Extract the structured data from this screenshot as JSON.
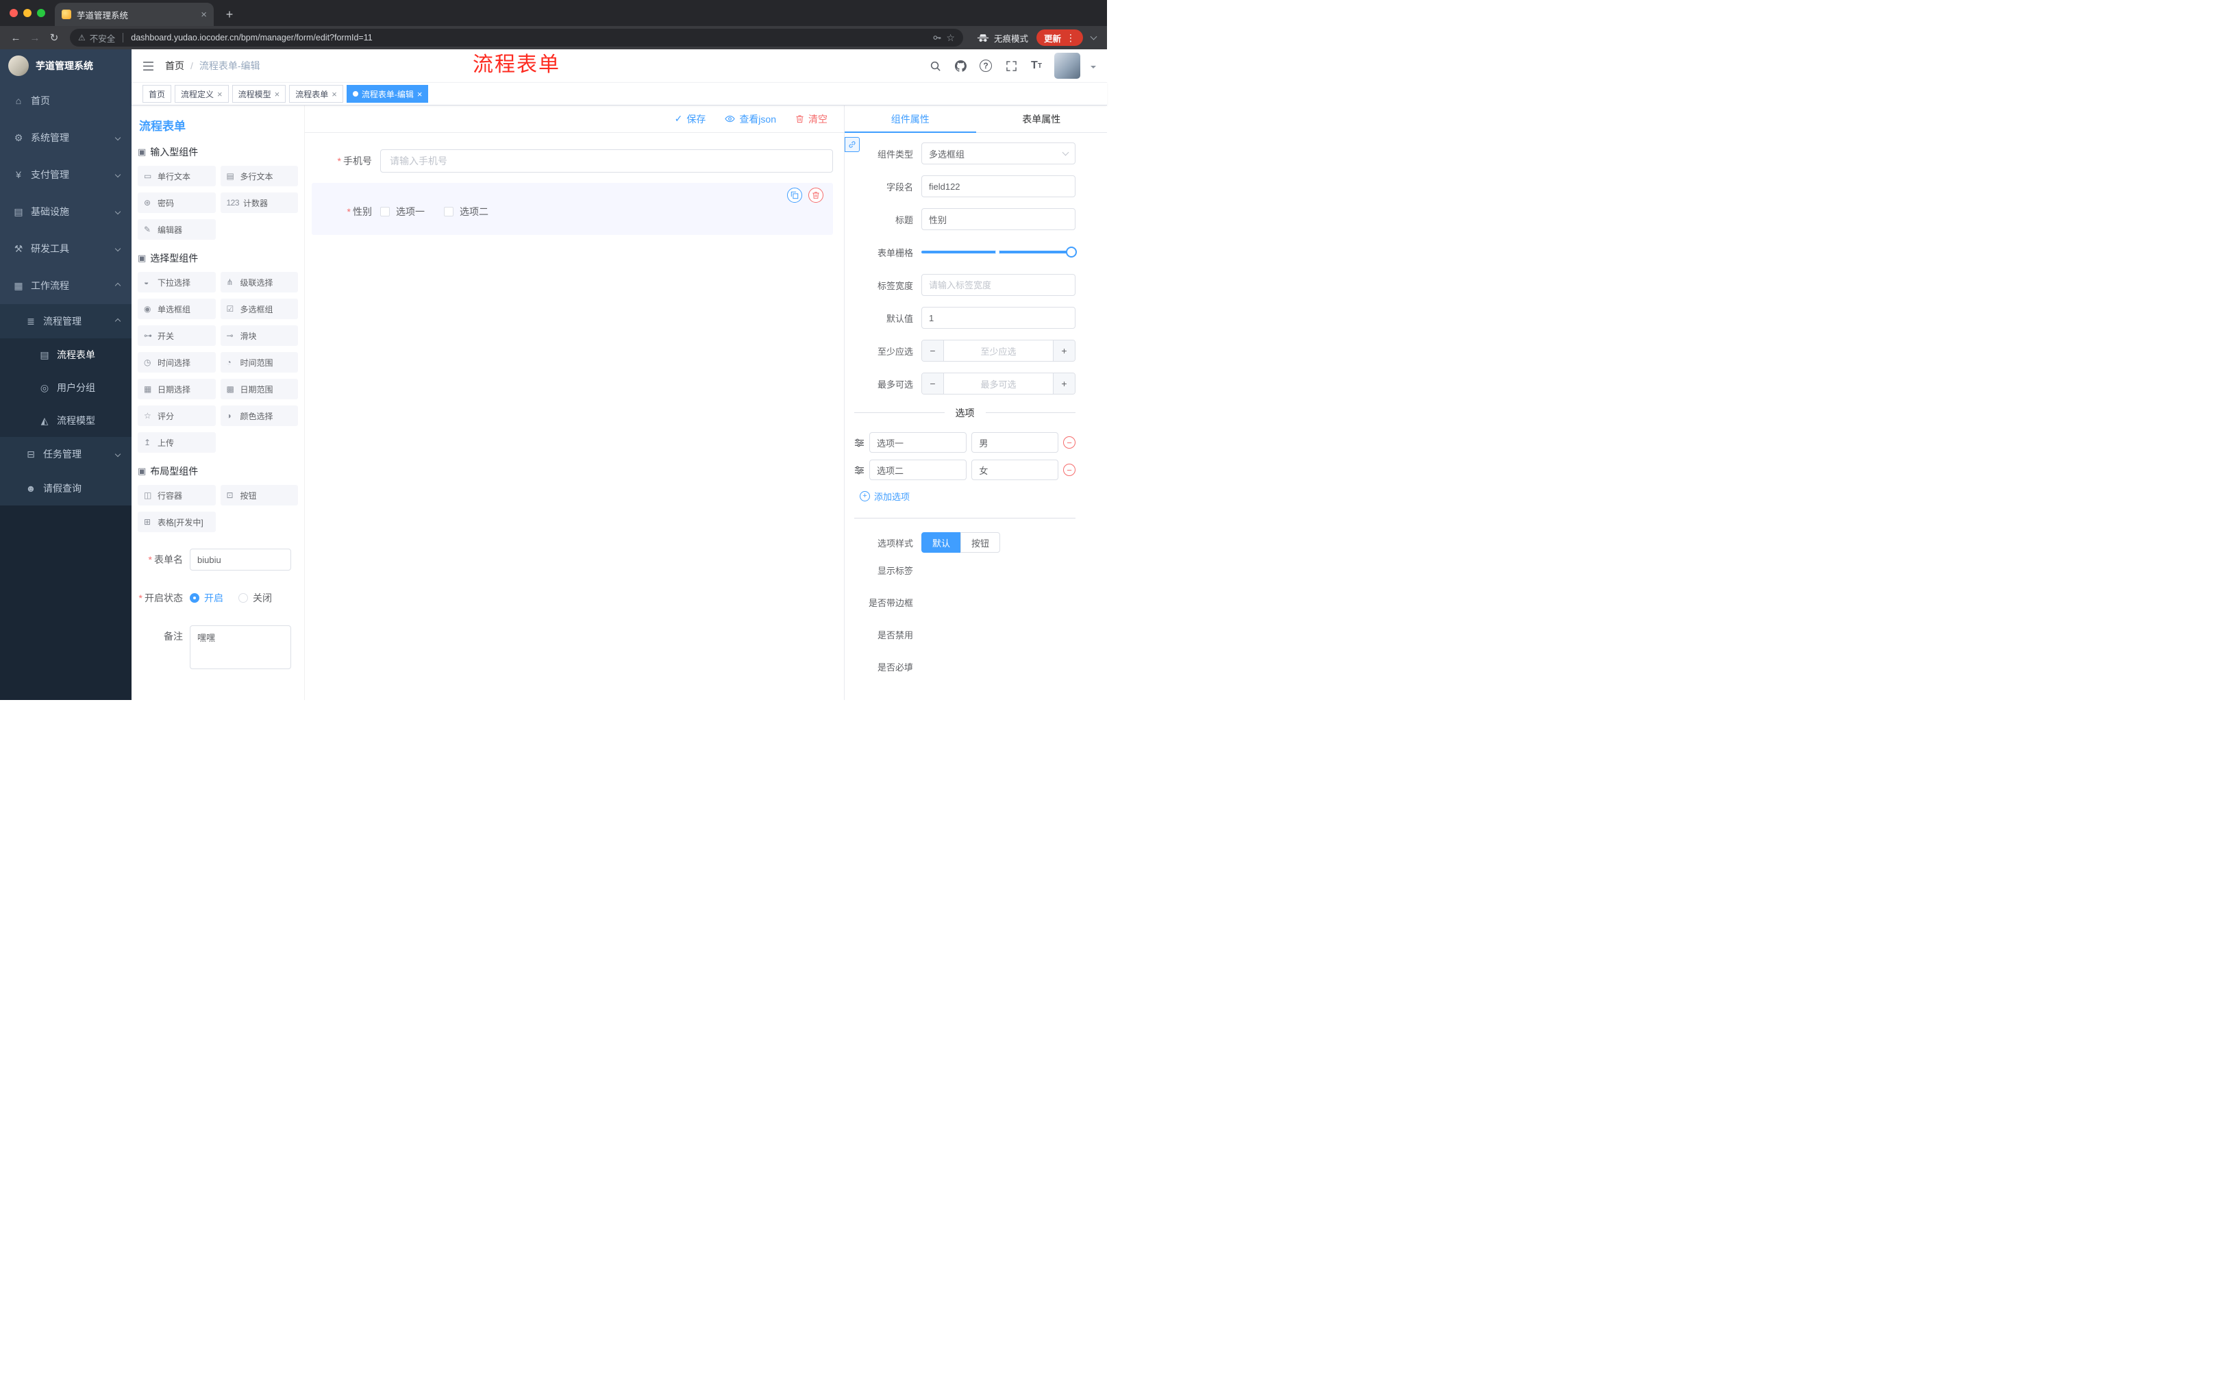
{
  "colors": {
    "accent": "#409EFF",
    "danger": "#F56C6C",
    "annotation_red": "#FD2B20",
    "sidebar_bg": "#304156",
    "active_tag_bg": "#409EFF"
  },
  "chrome": {
    "tab_title": "芋道管理系统",
    "security_label": "不安全",
    "url": "dashboard.yudao.iocoder.cn/bpm/manager/form/edit?formId=11",
    "incognito_label": "无痕模式",
    "update_label": "更新"
  },
  "sidebar": {
    "logo_title": "芋道管理系统",
    "items": [
      {
        "label": "首页",
        "icon": "home-icon",
        "glyph": "⌂"
      },
      {
        "label": "系统管理",
        "icon": "gear-icon",
        "glyph": "⚙"
      },
      {
        "label": "支付管理",
        "icon": "yen-icon",
        "glyph": "¥"
      },
      {
        "label": "基础设施",
        "icon": "infrastructure-icon",
        "glyph": "▤"
      },
      {
        "label": "研发工具",
        "icon": "tools-icon",
        "glyph": "⚒"
      },
      {
        "label": "工作流程",
        "icon": "workflow-icon",
        "glyph": "▦"
      },
      {
        "label": "流程管理",
        "icon": "list-icon",
        "glyph": "≣"
      },
      {
        "label": "流程表单",
        "icon": "document-icon",
        "glyph": "▤",
        "active": true
      },
      {
        "label": "用户分组",
        "icon": "users-icon",
        "glyph": "◎"
      },
      {
        "label": "流程模型",
        "icon": "send-icon",
        "glyph": "◭"
      },
      {
        "label": "任务管理",
        "icon": "tasks-icon",
        "glyph": "⊟"
      },
      {
        "label": "请假查询",
        "icon": "person-icon",
        "glyph": "☻"
      }
    ]
  },
  "header": {
    "breadcrumb_home": "首页",
    "breadcrumb_sep": "/",
    "breadcrumb_current": "流程表单-编辑",
    "annotation": "流程表单"
  },
  "tags": [
    {
      "label": "首页",
      "closable": false,
      "active": false
    },
    {
      "label": "流程定义",
      "closable": true,
      "active": false
    },
    {
      "label": "流程模型",
      "closable": true,
      "active": false
    },
    {
      "label": "流程表单",
      "closable": true,
      "active": false
    },
    {
      "label": "流程表单-编辑",
      "closable": true,
      "active": true
    }
  ],
  "designer": {
    "panel_title": "流程表单",
    "actions": {
      "save": "保存",
      "view_json": "查看json",
      "clear": "清空"
    },
    "sections": [
      {
        "title": "输入型组件",
        "glyph": "▣",
        "items": [
          {
            "label": "单行文本",
            "icon": "single-line-text-icon",
            "glyph": "▭"
          },
          {
            "label": "多行文本",
            "icon": "multi-line-text-icon",
            "glyph": "▤"
          },
          {
            "label": "密码",
            "icon": "password-icon",
            "glyph": "⊛"
          },
          {
            "label": "计数器",
            "icon": "counter-icon",
            "glyph": "123"
          },
          {
            "label": "编辑器",
            "icon": "editor-icon",
            "glyph": "✎"
          }
        ]
      },
      {
        "title": "选择型组件",
        "glyph": "▣",
        "items": [
          {
            "label": "下拉选择",
            "icon": "dropdown-icon",
            "glyph": "◒"
          },
          {
            "label": "级联选择",
            "icon": "cascader-icon",
            "glyph": "⋔"
          },
          {
            "label": "单选框组",
            "icon": "radio-group-icon",
            "glyph": "◉"
          },
          {
            "label": "多选框组",
            "icon": "checkbox-group-icon",
            "glyph": "☑"
          },
          {
            "label": "开关",
            "icon": "switch-icon",
            "glyph": "⊶"
          },
          {
            "label": "滑块",
            "icon": "slider-icon",
            "glyph": "⊸"
          },
          {
            "label": "时间选择",
            "icon": "time-picker-icon",
            "glyph": "◷"
          },
          {
            "label": "时间范围",
            "icon": "time-range-icon",
            "glyph": "◔"
          },
          {
            "label": "日期选择",
            "icon": "date-picker-icon",
            "glyph": "▦"
          },
          {
            "label": "日期范围",
            "icon": "date-range-icon",
            "glyph": "▩"
          },
          {
            "label": "评分",
            "icon": "rate-icon",
            "glyph": "☆"
          },
          {
            "label": "颜色选择",
            "icon": "color-picker-icon",
            "glyph": "◑"
          },
          {
            "label": "上传",
            "icon": "upload-icon",
            "glyph": "↥"
          }
        ]
      },
      {
        "title": "布局型组件",
        "glyph": "▣",
        "items": [
          {
            "label": "行容器",
            "icon": "row-container-icon",
            "glyph": "◫"
          },
          {
            "label": "按钮",
            "icon": "button-icon",
            "glyph": "⊡"
          },
          {
            "label": "表格[开发中]",
            "icon": "table-icon",
            "glyph": "⊞"
          }
        ]
      }
    ],
    "meta": {
      "name_label": "表单名",
      "name_value": "biubiu",
      "status_label": "开启状态",
      "status_on": "开启",
      "status_off": "关闭",
      "status_value": "开启",
      "remark_label": "备注",
      "remark_value": "嘿嘿"
    },
    "canvas": {
      "phone_label": "手机号",
      "phone_placeholder": "请输入手机号",
      "gender_label": "性别",
      "gender_options": [
        "选项一",
        "选项二"
      ]
    }
  },
  "props": {
    "tabs": {
      "component": "组件属性",
      "form": "表单属性"
    },
    "type_label": "组件类型",
    "type_value": "多选框组",
    "field_label": "字段名",
    "field_value": "field122",
    "title_label": "标题",
    "title_value": "性别",
    "grid_label": "表单栅格",
    "grid_value": 24,
    "grid_max": 24,
    "label_width_label": "标签宽度",
    "label_width_placeholder": "请输入标签宽度",
    "default_label": "默认值",
    "default_value": "1",
    "min_label": "至少应选",
    "min_placeholder": "至少应选",
    "max_label": "最多可选",
    "max_placeholder": "最多可选",
    "options_title": "选项",
    "options": [
      {
        "label": "选项一",
        "value": "男"
      },
      {
        "label": "选项二",
        "value": "女"
      }
    ],
    "add_option": "添加选项",
    "style_label": "选项样式",
    "style_default": "默认",
    "style_button": "按钮",
    "style_value": "默认",
    "show_label": "显示标签",
    "show_value": true,
    "border_label": "是否带边框",
    "border_value": false,
    "disabled_label": "是否禁用",
    "disabled_value": false,
    "required_label": "是否必填",
    "required_value": true
  }
}
